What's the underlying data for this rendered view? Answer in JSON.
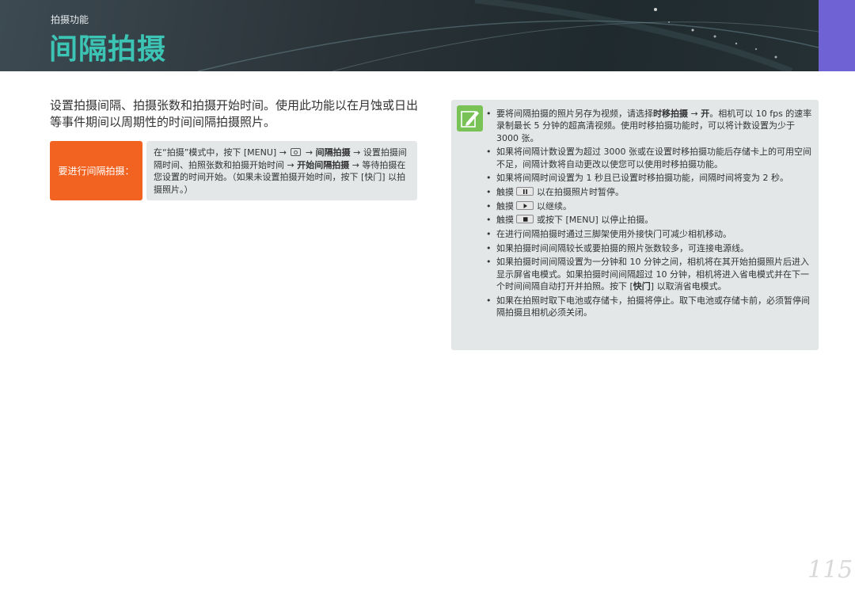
{
  "header": {
    "section_label": "拍摄功能",
    "page_title": "间隔拍摄",
    "accent_color": "#6f62d4",
    "title_color": "#3cc4b4"
  },
  "intro": {
    "text": "设置拍摄间隔、拍摄张数和拍摄开始时间。使用此功能以在月蚀或日出等事件期间以周期性的时间间隔拍摄照片。"
  },
  "step": {
    "label": "要进行间隔拍摄：",
    "label_color": "#f26322",
    "t1": "在“拍摄”模式中，按下 [MENU] →",
    "camera_icon": "camera-icon",
    "t2": "→",
    "bold1": "间隔拍摄",
    "t3": "→ 设置拍摄间隔时间、拍照张数和拍摄开始时间 →",
    "bold2": "开始间隔拍摄",
    "t4": "→ 等待拍摄在您设置的时间开始。（如果未设置拍摄开始时间，按下 [快门] 以拍摄照片。）"
  },
  "notes": {
    "icon": "pencil-note-icon",
    "items": [
      {
        "pre": "要将间隔拍摄的照片另存为视频，请选择",
        "bold1": "时移拍摄",
        "mid": " → ",
        "bold2": "开",
        "post": "。相机可以 10 fps 的速率录制最长 5 分钟的超高清视频。使用时移拍摄功能时，可以将计数设置为少于 3000 张。"
      },
      {
        "text": "如果将间隔计数设置为超过 3000 张或在设置时移拍摄功能后存储卡上的可用空间不足，间隔计数将自动更改以使您可以使用时移拍摄功能。"
      },
      {
        "text": "如果将间隔时间设置为 1 秒且已设置时移拍摄功能，间隔时间将变为 2 秒。"
      },
      {
        "pre": "触摸",
        "icon": "pause-icon",
        "post": "以在拍摄照片时暂停。"
      },
      {
        "pre": "触摸",
        "icon": "play-icon",
        "post": "以继续。"
      },
      {
        "pre": "触摸",
        "icon": "stop-icon",
        "post": "或按下 [MENU] 以停止拍摄。"
      },
      {
        "text": "在进行间隔拍摄时通过三脚架使用外接快门可减少相机移动。"
      },
      {
        "text": "如果拍摄时间间隔较长或要拍摄的照片张数较多，可连接电源线。"
      },
      {
        "pre": "如果拍摄时间间隔设置为一分钟和 10 分钟之间，相机将在其开始拍摄照片后进入显示屏省电模式。如果拍摄时间间隔超过 10 分钟，相机将进入省电模式并在下一个时间间隔自动打开并拍照。按下 [",
        "bold1": "快门",
        "post": "] 以取消省电模式。"
      },
      {
        "text": "如果在拍照时取下电池或存储卡，拍摄将停止。取下电池或存储卡前，必须暂停间隔拍摄且相机必须关闭。"
      }
    ]
  },
  "page_number": "115"
}
